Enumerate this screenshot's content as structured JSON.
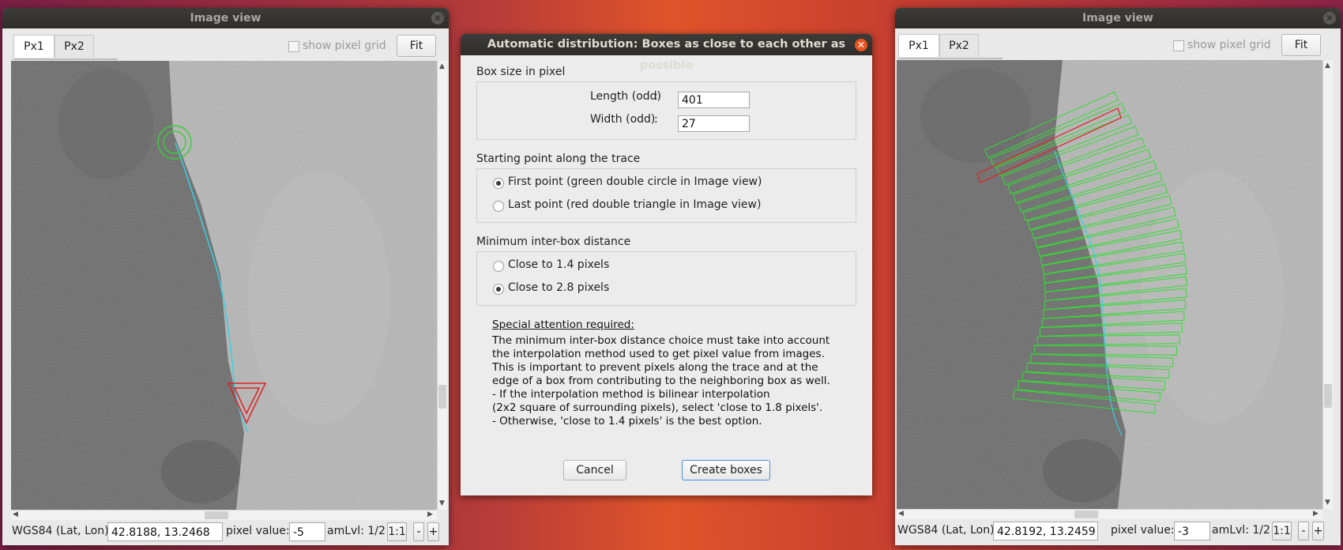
{
  "left_window": {
    "title": "Image view",
    "tabs": [
      "Px1",
      "Px2"
    ],
    "show_pixel_grid_label": "show pixel grid",
    "fit_label": "Fit",
    "status": {
      "coord_label": "WGS84 (Lat, Lon):",
      "coord_value": "42.8188, 13.2468",
      "pixel_label": "pixel value:",
      "pixel_value": "-5",
      "zoom_label": "amLvl: 1/2",
      "one_to_one": "1:1",
      "minus": "-",
      "plus": "+"
    }
  },
  "right_window": {
    "title": "Image view",
    "tabs": [
      "Px1",
      "Px2"
    ],
    "show_pixel_grid_label": "show pixel grid",
    "fit_label": "Fit",
    "status": {
      "coord_label": "WGS84 (Lat, Lon):",
      "coord_value": "42.8192, 13.2459",
      "pixel_label": "pixel value:",
      "pixel_value": "-3",
      "zoom_label": "amLvl: 1/2",
      "one_to_one": "1:1",
      "minus": "-",
      "plus": "+"
    }
  },
  "dialog": {
    "title": "Automatic distribution: Boxes as close to each other as possible",
    "box_size": {
      "heading": "Box size in pixel",
      "length_label": "Length (odd)",
      "length_value": "401",
      "width_label": "Width (odd)",
      "width_value": "27",
      "colon": ":"
    },
    "starting_point": {
      "heading": "Starting point along the trace",
      "options": [
        "First point (green double circle in Image view)",
        "Last point (red double triangle in Image view)"
      ],
      "selected": 0
    },
    "min_distance": {
      "heading": "Minimum inter-box distance",
      "options": [
        "Close to 1.4 pixels",
        "Close to 2.8 pixels"
      ],
      "selected": 1
    },
    "note": {
      "heading": "Special attention required:",
      "lines": [
        "The minimum inter-box distance choice must take into account",
        "the interpolation method used to get pixel value from images.",
        "This is important to prevent pixels along the trace and at the",
        "edge of a box from contributing to the neighboring box as well.",
        "- If the interpolation method is bilinear interpolation",
        "(2x2 square of surrounding pixels), select 'close to 1.8 pixels'.",
        "- Otherwise, 'close to 1.4 pixels' is the best option."
      ]
    },
    "cancel_label": "Cancel",
    "create_label": "Create boxes"
  },
  "colors": {
    "trace": "#39d0e0",
    "start_marker": "#3dcc3d",
    "end_marker": "#dd2222",
    "boxes": "#33dd33",
    "first_box": "#dd2222",
    "accent_close": "#e95420"
  }
}
